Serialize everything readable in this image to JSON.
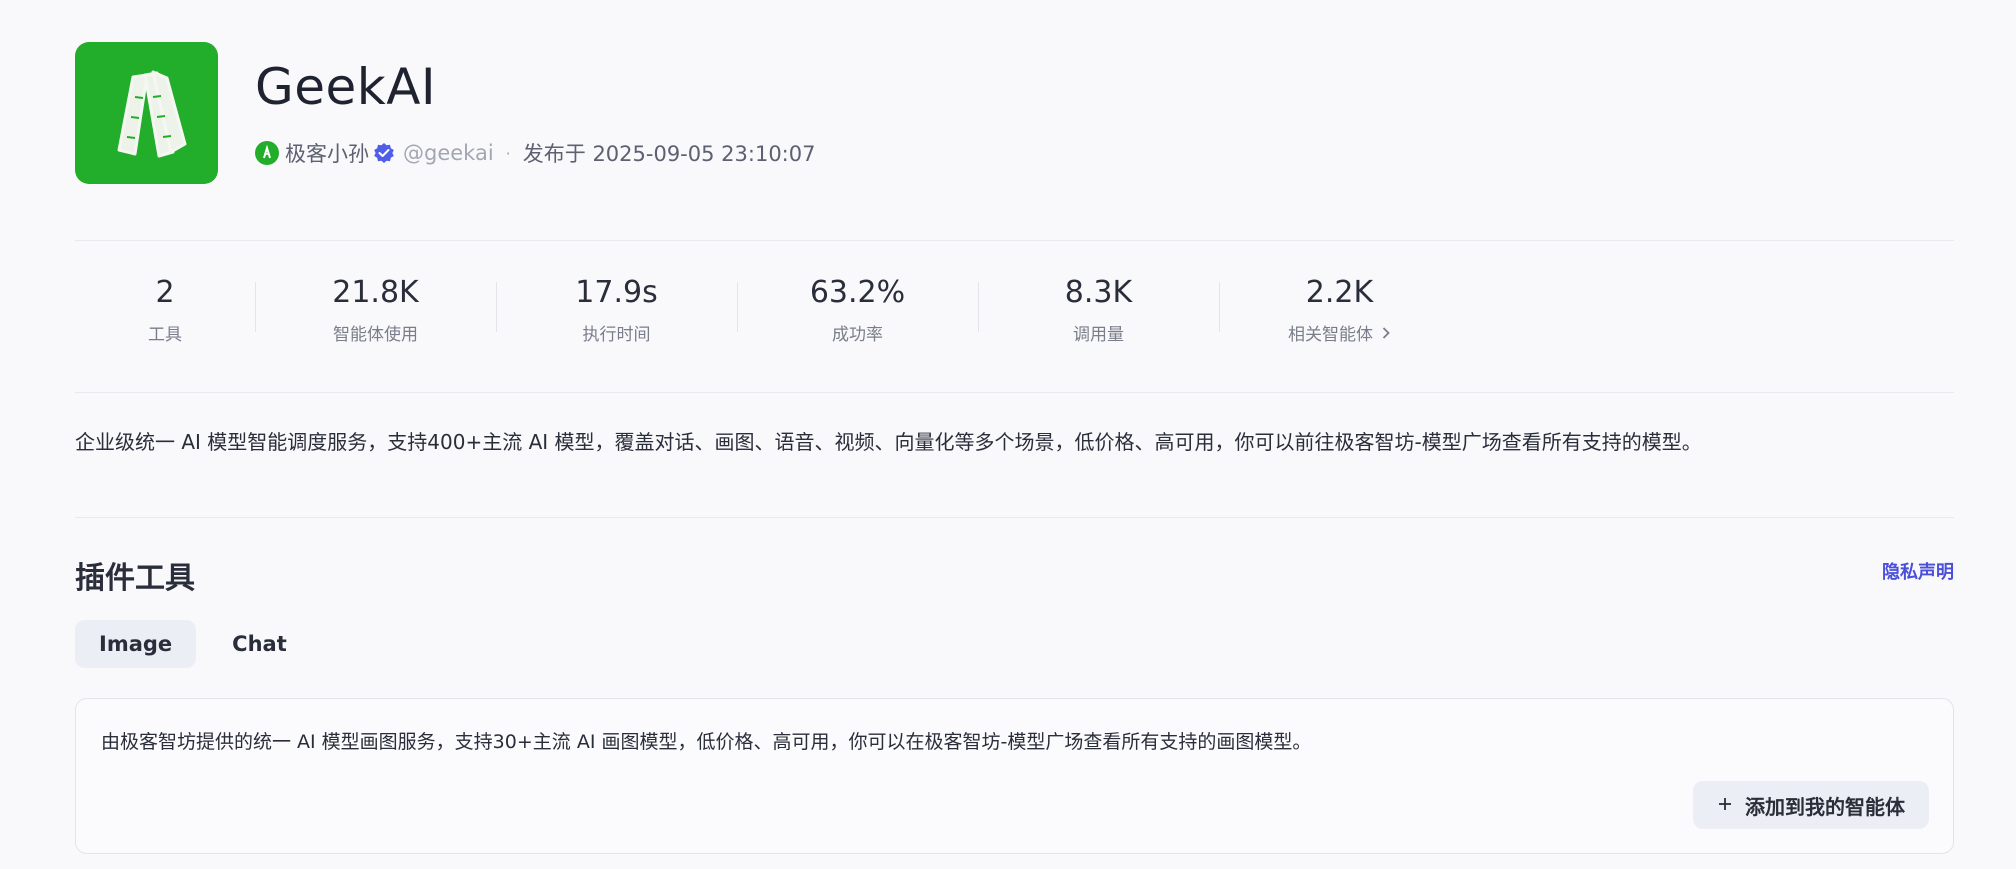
{
  "header": {
    "title": "GeekAI",
    "author_name": "极客小孙",
    "author_handle": "@geekai",
    "dot": "·",
    "published": "发布于 2025-09-05 23:10:07"
  },
  "stats": [
    {
      "value": "2",
      "label": "工具"
    },
    {
      "value": "21.8K",
      "label": "智能体使用"
    },
    {
      "value": "17.9s",
      "label": "执行时间"
    },
    {
      "value": "63.2%",
      "label": "成功率"
    },
    {
      "value": "8.3K",
      "label": "调用量"
    },
    {
      "value": "2.2K",
      "label": "相关智能体"
    }
  ],
  "description": "企业级统一 AI 模型智能调度服务，支持400+主流 AI 模型，覆盖对话、画图、语音、视频、向量化等多个场景，低价格、高可用，你可以前往极客智坊-模型广场查看所有支持的模型。",
  "plugins": {
    "title": "插件工具",
    "privacy_link": "隐私声明",
    "tabs": [
      "Image",
      "Chat"
    ],
    "active_tab": "Image",
    "card": {
      "text": "由极客智坊提供的统一 AI 模型画图服务，支持30+主流 AI 画图模型，低价格、高可用，你可以在极客智坊-模型广场查看所有支持的画图模型。",
      "add_label": "添加到我的智能体"
    }
  },
  "icons": {
    "logo": "geekai-logo-icon",
    "avatar": "author-avatar-icon",
    "verified": "verified-badge-icon",
    "chevron": "chevron-right-icon",
    "plus": "plus-icon"
  },
  "colors": {
    "brand_green": "#22ad2a",
    "link_blue": "#4b4fd9",
    "verified_blue": "#4f5ee8"
  }
}
